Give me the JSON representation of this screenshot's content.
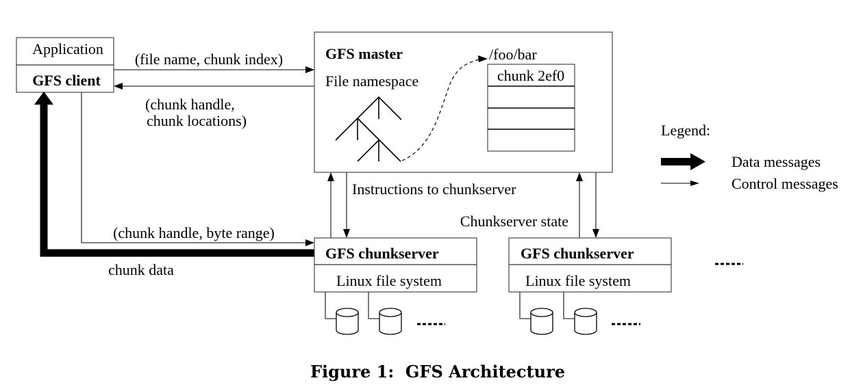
{
  "diagram": {
    "client_box": {
      "top_label": "Application",
      "bottom_label": "GFS client"
    },
    "master_box": {
      "title": "GFS master",
      "namespace_label": "File namespace",
      "file_path": "/foo/bar",
      "chunk_table": [
        "chunk 2ef0",
        "",
        "",
        ""
      ]
    },
    "edges": {
      "request": "(file name, chunk index)",
      "reply_line1": "(chunk handle,",
      "reply_line2": " chunk locations)",
      "instructions": "Instructions to chunkserver",
      "state": "Chunkserver state",
      "read_request": "(chunk handle, byte range)",
      "chunk_data": "chunk data"
    },
    "chunkservers": [
      {
        "title": "GFS chunkserver",
        "fs": "Linux file system"
      },
      {
        "title": "GFS chunkserver",
        "fs": "Linux file system"
      }
    ],
    "legend": {
      "title": "Legend:",
      "data": "Data messages",
      "control": "Control messages"
    },
    "caption": "Figure 1:  GFS Architecture"
  }
}
